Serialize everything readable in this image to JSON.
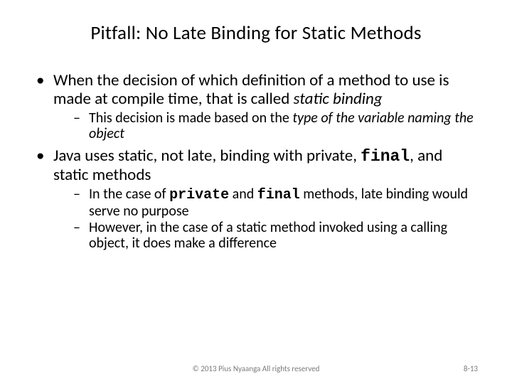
{
  "title": "Pitfall:  No Late Binding for Static Methods",
  "b1": {
    "pre": "When the decision of which definition of a method to use is made at compile time, that is called ",
    "em": "static binding",
    "sub1_pre": "This decision is made based on the ",
    "sub1_em": "type of the variable naming the object"
  },
  "b2": {
    "pre": "Java uses static, not late, binding with private, ",
    "code": "final",
    "post": ", and static methods",
    "sub1_pre": "In the case of ",
    "sub1_code1": "private",
    "sub1_mid": " and ",
    "sub1_code2": "final",
    "sub1_post": " methods, late binding would serve no purpose",
    "sub2": "However, in the case of a static method invoked using a calling object, it does make a difference"
  },
  "footer": {
    "copyright": "© 2013 Pius Nyaanga  All rights reserved",
    "page": "8-13"
  }
}
